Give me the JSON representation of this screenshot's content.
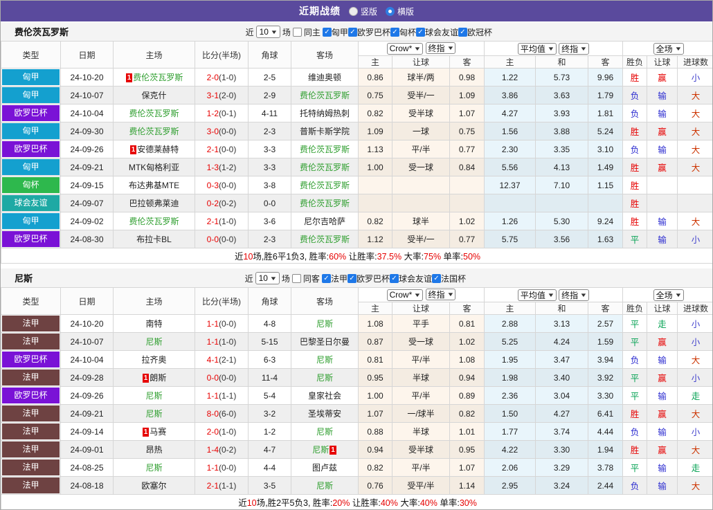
{
  "header": {
    "title": "近期战绩",
    "layout_options": [
      {
        "label": "竖版",
        "checked": false
      },
      {
        "label": "横版",
        "checked": true
      }
    ]
  },
  "filter": {
    "near": "近",
    "count": "10",
    "games": "场"
  },
  "columns": {
    "left": [
      "类型",
      "日期",
      "主场",
      "比分(半场)",
      "角球",
      "客场"
    ],
    "selects": {
      "crow": "Crow*",
      "crow_ref": "终指",
      "avg": "平均值",
      "avg_ref": "终指",
      "scope": "全场"
    },
    "sub": [
      "主",
      "让球",
      "客",
      "主",
      "和",
      "客",
      "胜负",
      "让球",
      "进球数"
    ]
  },
  "colors": {
    "leagues": {
      "匈甲": "#14a0cf",
      "欧罗巴杯": "#7a12d6",
      "匈杯": "#2eb84d",
      "球会友谊": "#1ea9a4",
      "法甲": "#6e4242"
    },
    "outcomes": {
      "胜": "#e60000",
      "赢": "#e60000",
      "负": "#2d2dd0",
      "输": "#2d2dd0",
      "平": "#00a050",
      "走": "#00a050",
      "大": "#cc3300",
      "小": "#4040cc"
    },
    "team_highlight": "#2e9e2e",
    "score": "#e80000"
  },
  "tables": [
    {
      "team": "费伦茨瓦罗斯",
      "same_label": "同主",
      "same_checked": false,
      "leagues": [
        {
          "label": "匈甲",
          "checked": true
        },
        {
          "label": "欧罗巴杯",
          "checked": true
        },
        {
          "label": "匈杯",
          "checked": true
        },
        {
          "label": "球会友谊",
          "checked": true
        },
        {
          "label": "欧冠杯",
          "checked": true
        }
      ],
      "rows": [
        {
          "league": "匈甲",
          "date": "24-10-20",
          "home": {
            "name": "费伦茨瓦罗斯",
            "green": true,
            "badge": "before"
          },
          "score": "2-0",
          "half": "(1-0)",
          "corners": "2-5",
          "away": {
            "name": "维迪奥顿"
          },
          "crow": [
            "0.86",
            "球半/两",
            "0.98"
          ],
          "avg": [
            "1.22",
            "5.73",
            "9.96"
          ],
          "outcome": [
            "胜",
            "赢",
            "小"
          ]
        },
        {
          "league": "匈甲",
          "date": "24-10-07",
          "home": {
            "name": "保克什"
          },
          "score": "3-1",
          "half": "(2-0)",
          "corners": "2-9",
          "away": {
            "name": "费伦茨瓦罗斯",
            "green": true
          },
          "crow": [
            "0.75",
            "受半/一",
            "1.09"
          ],
          "avg": [
            "3.86",
            "3.63",
            "1.79"
          ],
          "outcome": [
            "负",
            "输",
            "大"
          ]
        },
        {
          "league": "欧罗巴杯",
          "date": "24-10-04",
          "home": {
            "name": "费伦茨瓦罗斯",
            "green": true
          },
          "score": "1-2",
          "half": "(0-1)",
          "corners": "4-11",
          "away": {
            "name": "托特纳姆热刺"
          },
          "crow": [
            "0.82",
            "受半球",
            "1.07"
          ],
          "avg": [
            "4.27",
            "3.93",
            "1.81"
          ],
          "outcome": [
            "负",
            "输",
            "大"
          ]
        },
        {
          "league": "匈甲",
          "date": "24-09-30",
          "home": {
            "name": "费伦茨瓦罗斯",
            "green": true
          },
          "score": "3-0",
          "half": "(0-0)",
          "corners": "2-3",
          "away": {
            "name": "普斯卡斯学院"
          },
          "crow": [
            "1.09",
            "一球",
            "0.75"
          ],
          "avg": [
            "1.56",
            "3.88",
            "5.24"
          ],
          "outcome": [
            "胜",
            "赢",
            "大"
          ]
        },
        {
          "league": "欧罗巴杯",
          "date": "24-09-26",
          "home": {
            "name": "安德莱赫特",
            "badge": "before"
          },
          "score": "2-1",
          "half": "(0-0)",
          "corners": "3-3",
          "away": {
            "name": "费伦茨瓦罗斯",
            "green": true
          },
          "crow": [
            "1.13",
            "平/半",
            "0.77"
          ],
          "avg": [
            "2.30",
            "3.35",
            "3.10"
          ],
          "outcome": [
            "负",
            "输",
            "大"
          ]
        },
        {
          "league": "匈甲",
          "date": "24-09-21",
          "home": {
            "name": "MTK匈格利亚"
          },
          "score": "1-3",
          "half": "(1-2)",
          "corners": "3-3",
          "away": {
            "name": "费伦茨瓦罗斯",
            "green": true
          },
          "crow": [
            "1.00",
            "受一球",
            "0.84"
          ],
          "avg": [
            "5.56",
            "4.13",
            "1.49"
          ],
          "outcome": [
            "胜",
            "赢",
            "大"
          ]
        },
        {
          "league": "匈杯",
          "date": "24-09-15",
          "home": {
            "name": "布达弗基MTE"
          },
          "score": "0-3",
          "half": "(0-0)",
          "corners": "3-8",
          "away": {
            "name": "费伦茨瓦罗斯",
            "green": true
          },
          "crow": [
            "",
            "",
            ""
          ],
          "avg": [
            "12.37",
            "7.10",
            "1.15"
          ],
          "outcome": [
            "胜",
            "",
            ""
          ]
        },
        {
          "league": "球会友谊",
          "date": "24-09-07",
          "home": {
            "name": "巴拉顿弗莱迪"
          },
          "score": "0-2",
          "half": "(0-2)",
          "corners": "0-0",
          "away": {
            "name": "费伦茨瓦罗斯",
            "green": true
          },
          "crow": [
            "",
            "",
            ""
          ],
          "avg": [
            "",
            "",
            ""
          ],
          "outcome": [
            "胜",
            "",
            ""
          ]
        },
        {
          "league": "匈甲",
          "date": "24-09-02",
          "home": {
            "name": "费伦茨瓦罗斯",
            "green": true
          },
          "score": "2-1",
          "half": "(1-0)",
          "corners": "3-6",
          "away": {
            "name": "尼尔吉哈萨"
          },
          "crow": [
            "0.82",
            "球半",
            "1.02"
          ],
          "avg": [
            "1.26",
            "5.30",
            "9.24"
          ],
          "outcome": [
            "胜",
            "输",
            "大"
          ]
        },
        {
          "league": "欧罗巴杯",
          "date": "24-08-30",
          "home": {
            "name": "布拉卡BL"
          },
          "score": "0-0",
          "half": "(0-0)",
          "corners": "2-3",
          "away": {
            "name": "费伦茨瓦罗斯",
            "green": true
          },
          "crow": [
            "1.12",
            "受半/一",
            "0.77"
          ],
          "avg": [
            "5.75",
            "3.56",
            "1.63"
          ],
          "outcome": [
            "平",
            "输",
            "小"
          ]
        }
      ],
      "summary": [
        {
          "text": "近"
        },
        {
          "text": "10",
          "red": true
        },
        {
          "text": "场,胜6平1负3, 胜率:"
        },
        {
          "text": "60%",
          "red": true
        },
        {
          "text": " 让胜率:"
        },
        {
          "text": "37.5%",
          "red": true
        },
        {
          "text": " 大率:"
        },
        {
          "text": "75%",
          "red": true
        },
        {
          "text": " 单率:"
        },
        {
          "text": "50%",
          "red": true
        }
      ]
    },
    {
      "team": "尼斯",
      "same_label": "同客",
      "same_checked": false,
      "leagues": [
        {
          "label": "法甲",
          "checked": true
        },
        {
          "label": "欧罗巴杯",
          "checked": true
        },
        {
          "label": "球会友谊",
          "checked": true
        },
        {
          "label": "法国杯",
          "checked": true
        }
      ],
      "rows": [
        {
          "league": "法甲",
          "date": "24-10-20",
          "home": {
            "name": "南特"
          },
          "score": "1-1",
          "half": "(0-0)",
          "corners": "4-8",
          "away": {
            "name": "尼斯",
            "green": true
          },
          "crow": [
            "1.08",
            "平手",
            "0.81"
          ],
          "avg": [
            "2.88",
            "3.13",
            "2.57"
          ],
          "outcome": [
            "平",
            "走",
            "小"
          ]
        },
        {
          "league": "法甲",
          "date": "24-10-07",
          "home": {
            "name": "尼斯",
            "green": true
          },
          "score": "1-1",
          "half": "(1-0)",
          "corners": "5-15",
          "away": {
            "name": "巴黎圣日尔曼"
          },
          "crow": [
            "0.87",
            "受一球",
            "1.02"
          ],
          "avg": [
            "5.25",
            "4.24",
            "1.59"
          ],
          "outcome": [
            "平",
            "赢",
            "小"
          ]
        },
        {
          "league": "欧罗巴杯",
          "date": "24-10-04",
          "home": {
            "name": "拉齐奥"
          },
          "score": "4-1",
          "half": "(2-1)",
          "corners": "6-3",
          "away": {
            "name": "尼斯",
            "green": true
          },
          "crow": [
            "0.81",
            "平/半",
            "1.08"
          ],
          "avg": [
            "1.95",
            "3.47",
            "3.94"
          ],
          "outcome": [
            "负",
            "输",
            "大"
          ]
        },
        {
          "league": "法甲",
          "date": "24-09-28",
          "home": {
            "name": "朗斯",
            "badge": "before"
          },
          "score": "0-0",
          "half": "(0-0)",
          "corners": "11-4",
          "away": {
            "name": "尼斯",
            "green": true
          },
          "crow": [
            "0.95",
            "半球",
            "0.94"
          ],
          "avg": [
            "1.98",
            "3.40",
            "3.92"
          ],
          "outcome": [
            "平",
            "赢",
            "小"
          ]
        },
        {
          "league": "欧罗巴杯",
          "date": "24-09-26",
          "home": {
            "name": "尼斯",
            "green": true
          },
          "score": "1-1",
          "half": "(1-1)",
          "corners": "5-4",
          "away": {
            "name": "皇家社会"
          },
          "crow": [
            "1.00",
            "平/半",
            "0.89"
          ],
          "avg": [
            "2.36",
            "3.04",
            "3.30"
          ],
          "outcome": [
            "平",
            "输",
            "走"
          ]
        },
        {
          "league": "法甲",
          "date": "24-09-21",
          "home": {
            "name": "尼斯",
            "green": true
          },
          "score": "8-0",
          "half": "(6-0)",
          "corners": "3-2",
          "away": {
            "name": "圣埃蒂安"
          },
          "crow": [
            "1.07",
            "一/球半",
            "0.82"
          ],
          "avg": [
            "1.50",
            "4.27",
            "6.41"
          ],
          "outcome": [
            "胜",
            "赢",
            "大"
          ]
        },
        {
          "league": "法甲",
          "date": "24-09-14",
          "home": {
            "name": "马赛",
            "badge": "before"
          },
          "score": "2-0",
          "half": "(1-0)",
          "corners": "1-2",
          "away": {
            "name": "尼斯",
            "green": true
          },
          "crow": [
            "0.88",
            "半球",
            "1.01"
          ],
          "avg": [
            "1.77",
            "3.74",
            "4.44"
          ],
          "outcome": [
            "负",
            "输",
            "小"
          ]
        },
        {
          "league": "法甲",
          "date": "24-09-01",
          "home": {
            "name": "昂热"
          },
          "score": "1-4",
          "half": "(0-2)",
          "corners": "4-7",
          "away": {
            "name": "尼斯",
            "green": true,
            "badge": "after"
          },
          "crow": [
            "0.94",
            "受半球",
            "0.95"
          ],
          "avg": [
            "4.22",
            "3.30",
            "1.94"
          ],
          "outcome": [
            "胜",
            "赢",
            "大"
          ]
        },
        {
          "league": "法甲",
          "date": "24-08-25",
          "home": {
            "name": "尼斯",
            "green": true
          },
          "score": "1-1",
          "half": "(0-0)",
          "corners": "4-4",
          "away": {
            "name": "图卢兹"
          },
          "crow": [
            "0.82",
            "平/半",
            "1.07"
          ],
          "avg": [
            "2.06",
            "3.29",
            "3.78"
          ],
          "outcome": [
            "平",
            "输",
            "走"
          ]
        },
        {
          "league": "法甲",
          "date": "24-08-18",
          "home": {
            "name": "欧塞尔"
          },
          "score": "2-1",
          "half": "(1-1)",
          "corners": "3-5",
          "away": {
            "name": "尼斯",
            "green": true
          },
          "crow": [
            "0.76",
            "受平/半",
            "1.14"
          ],
          "avg": [
            "2.95",
            "3.24",
            "2.44"
          ],
          "outcome": [
            "负",
            "输",
            "大"
          ]
        }
      ],
      "summary": [
        {
          "text": "近"
        },
        {
          "text": "10",
          "red": true
        },
        {
          "text": "场,胜2平5负3, 胜率:"
        },
        {
          "text": "20%",
          "red": true
        },
        {
          "text": " 让胜率:"
        },
        {
          "text": "40%",
          "red": true
        },
        {
          "text": " 大率:"
        },
        {
          "text": "40%",
          "red": true
        },
        {
          "text": " 单率:"
        },
        {
          "text": "30%",
          "red": true
        }
      ]
    }
  ]
}
